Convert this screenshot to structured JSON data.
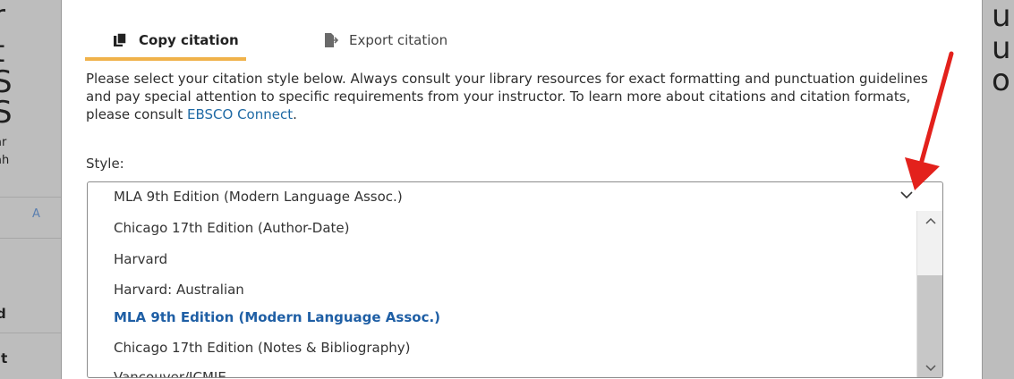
{
  "modal": {
    "tabs": [
      {
        "label": "Copy citation",
        "icon": "copy-icon",
        "active": true
      },
      {
        "label": "Export citation",
        "icon": "export-icon",
        "active": false
      }
    ],
    "intro_text": "Please select your citation style below. Always consult your library resources for exact formatting and punctuation guidelines and pay special attention to specific requirements from your instructor. To learn more about citations and citation formats, please consult ",
    "intro_link": "EBSCO Connect",
    "intro_end": ".",
    "style_label": "Style:",
    "select": {
      "selected": "MLA 9th Edition (Modern Language Assoc.)",
      "options": [
        "Chicago 17th Edition (Author-Date)",
        "Harvard",
        "Harvard: Australian",
        "MLA 9th Edition (Modern Language Assoc.)",
        "Chicago 17th Edition (Notes & Bibliography)",
        "Vancouver/ICMJE"
      ],
      "active_index": 3
    }
  },
  "colors": {
    "accent_tab": "#f0b24a",
    "link": "#1f6aa5",
    "annotation_arrow": "#e3211c"
  }
}
